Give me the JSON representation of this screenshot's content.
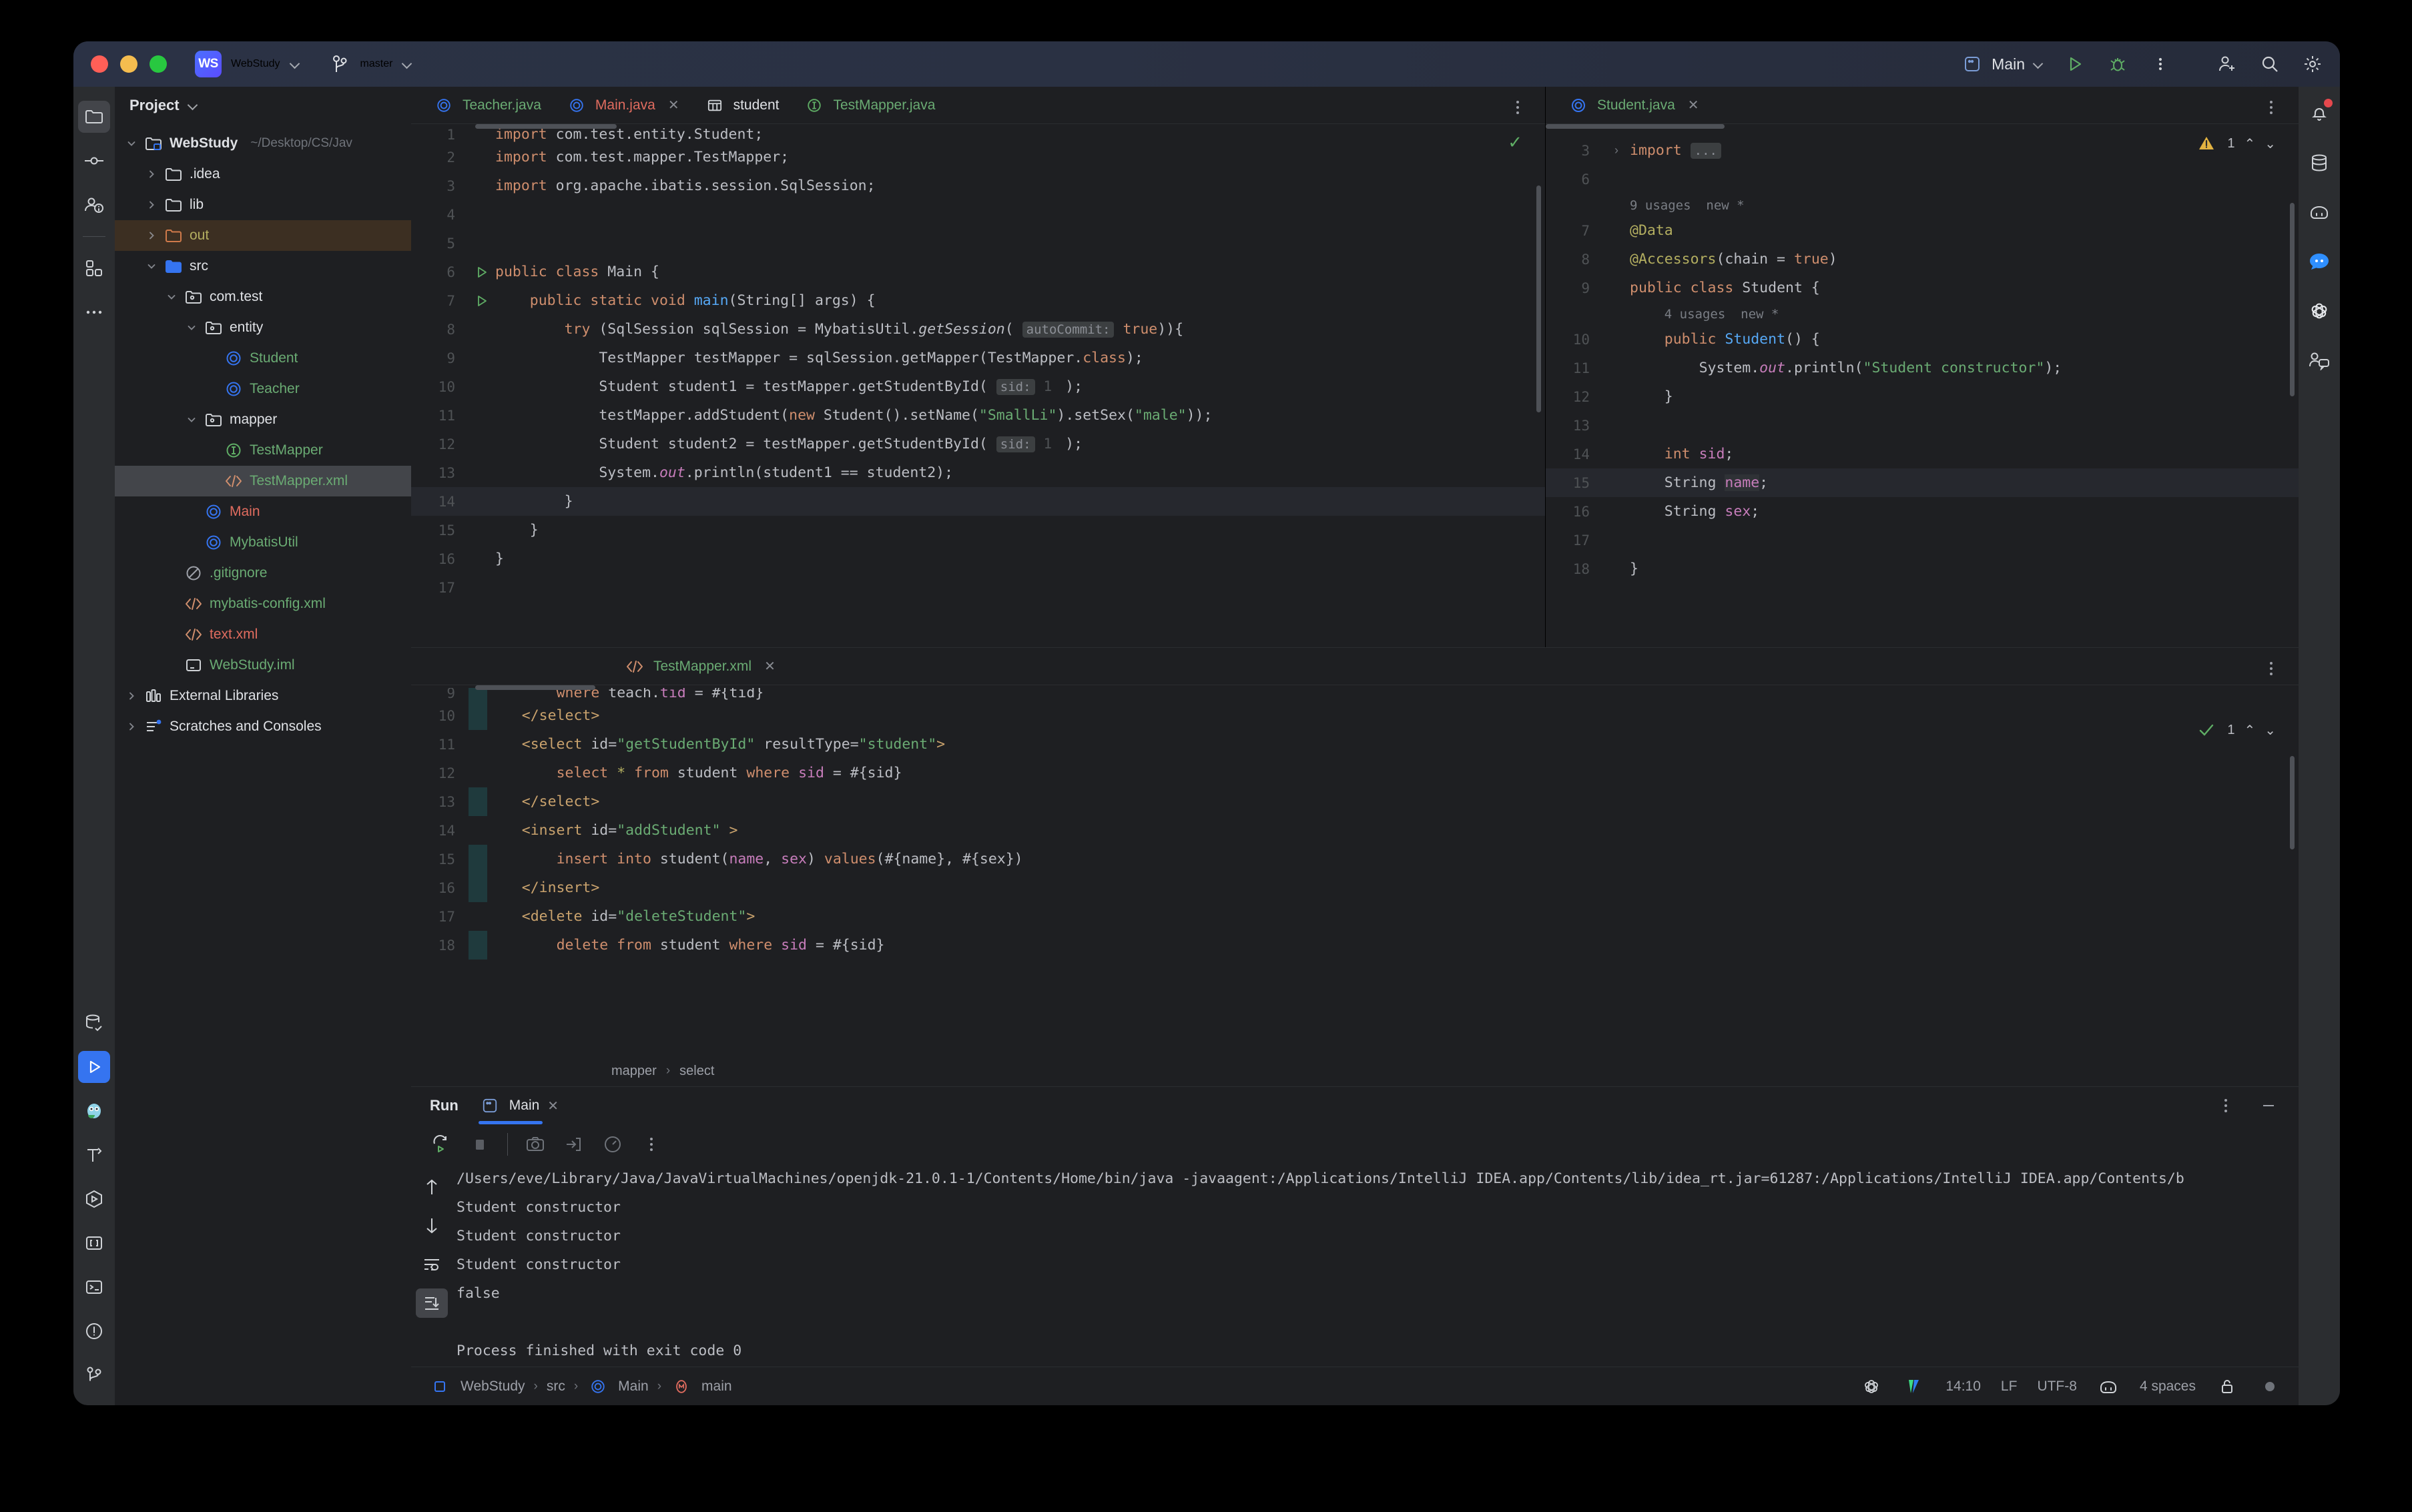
{
  "titlebar": {
    "project_badge": "WS",
    "project_name": "WebStudy",
    "branch": "master",
    "run_config": "Main"
  },
  "left_rail": {
    "items": [
      {
        "name": "project-tool-window",
        "icon": "folder-icon",
        "active": true
      },
      {
        "name": "commit-tool-window",
        "icon": "commit-icon",
        "active": false
      },
      {
        "name": "pull-requests-tool-window",
        "icon": "pull-request-icon",
        "active": false
      },
      {
        "name": "structure-tool-window",
        "icon": "structure-icon",
        "active": false
      },
      {
        "name": "more-tool-windows",
        "icon": "more-dots-icon",
        "active": false
      }
    ],
    "bottom_items": [
      {
        "name": "database-tool-window",
        "icon": "database-check-icon",
        "active": false
      },
      {
        "name": "run-tool-window",
        "icon": "run-icon",
        "active": true
      },
      {
        "name": "owl-assistant",
        "icon": "owl-icon",
        "active": false
      },
      {
        "name": "build-tool-window",
        "icon": "hammer-icon",
        "active": false
      },
      {
        "name": "services-tool-window",
        "icon": "services-icon",
        "active": false
      },
      {
        "name": "bracket-tool-window",
        "icon": "brackets-icon",
        "active": false
      },
      {
        "name": "terminal-tool-window",
        "icon": "terminal-icon",
        "active": false
      },
      {
        "name": "problems-tool-window",
        "icon": "warning-circle-icon",
        "active": false
      },
      {
        "name": "git-tool-window",
        "icon": "git-branch-icon",
        "active": false
      }
    ]
  },
  "right_rail": {
    "items": [
      {
        "name": "notifications",
        "icon": "bell-icon",
        "badge": true
      },
      {
        "name": "database",
        "icon": "database-icon",
        "badge": false
      },
      {
        "name": "copilot",
        "icon": "robot-icon",
        "badge": false
      },
      {
        "name": "chat",
        "icon": "chat-bubble-icon",
        "badge": false
      },
      {
        "name": "openai-assistant",
        "icon": "openai-icon",
        "badge": false
      },
      {
        "name": "code-with-me",
        "icon": "people-chat-icon",
        "badge": false
      }
    ]
  },
  "project_panel": {
    "title": "Project",
    "tree": [
      {
        "label": "WebStudy",
        "suffix": "~/Desktop/CS/Jav",
        "depth": 0,
        "twist": "down",
        "icon": "module-folder-icon",
        "color": "white",
        "bold": true,
        "state": "normal"
      },
      {
        "label": ".idea",
        "suffix": "",
        "depth": 1,
        "twist": "right",
        "icon": "folder-icon",
        "color": "white",
        "bold": false,
        "state": "normal"
      },
      {
        "label": "lib",
        "suffix": "",
        "depth": 1,
        "twist": "right",
        "icon": "folder-icon",
        "color": "white",
        "bold": false,
        "state": "normal"
      },
      {
        "label": "out",
        "suffix": "",
        "depth": 1,
        "twist": "right",
        "icon": "folder-excluded-icon",
        "color": "yellow",
        "bold": false,
        "state": "highlight"
      },
      {
        "label": "src",
        "suffix": "",
        "depth": 1,
        "twist": "down",
        "icon": "source-folder-icon",
        "color": "white",
        "bold": false,
        "state": "normal"
      },
      {
        "label": "com.test",
        "suffix": "",
        "depth": 2,
        "twist": "down",
        "icon": "package-icon",
        "color": "white",
        "bold": false,
        "state": "normal"
      },
      {
        "label": "entity",
        "suffix": "",
        "depth": 3,
        "twist": "down",
        "icon": "package-icon",
        "color": "white",
        "bold": false,
        "state": "normal"
      },
      {
        "label": "Student",
        "suffix": "",
        "depth": 4,
        "twist": "none",
        "icon": "java-class-icon",
        "color": "green",
        "bold": false,
        "state": "normal"
      },
      {
        "label": "Teacher",
        "suffix": "",
        "depth": 4,
        "twist": "none",
        "icon": "java-class-icon",
        "color": "green",
        "bold": false,
        "state": "normal"
      },
      {
        "label": "mapper",
        "suffix": "",
        "depth": 3,
        "twist": "down",
        "icon": "package-icon",
        "color": "white",
        "bold": false,
        "state": "normal"
      },
      {
        "label": "TestMapper",
        "suffix": "",
        "depth": 4,
        "twist": "none",
        "icon": "java-interface-icon",
        "color": "green",
        "bold": false,
        "state": "normal"
      },
      {
        "label": "TestMapper.xml",
        "suffix": "",
        "depth": 4,
        "twist": "none",
        "icon": "xml-icon",
        "color": "green",
        "bold": false,
        "state": "selected"
      },
      {
        "label": "Main",
        "suffix": "",
        "depth": 3,
        "twist": "none",
        "icon": "java-class-icon",
        "color": "red",
        "bold": false,
        "state": "normal"
      },
      {
        "label": "MybatisUtil",
        "suffix": "",
        "depth": 3,
        "twist": "none",
        "icon": "java-class-icon",
        "color": "green",
        "bold": false,
        "state": "normal"
      },
      {
        "label": ".gitignore",
        "suffix": "",
        "depth": 2,
        "twist": "none",
        "icon": "gitignore-icon",
        "color": "green",
        "bold": false,
        "state": "normal"
      },
      {
        "label": "mybatis-config.xml",
        "suffix": "",
        "depth": 2,
        "twist": "none",
        "icon": "xml-icon",
        "color": "green",
        "bold": false,
        "state": "normal"
      },
      {
        "label": "text.xml",
        "suffix": "",
        "depth": 2,
        "twist": "none",
        "icon": "xml-icon",
        "color": "red",
        "bold": false,
        "state": "normal"
      },
      {
        "label": "WebStudy.iml",
        "suffix": "",
        "depth": 2,
        "twist": "none",
        "icon": "iml-icon",
        "color": "green",
        "bold": false,
        "state": "normal"
      },
      {
        "label": "External Libraries",
        "suffix": "",
        "depth": 0,
        "twist": "right",
        "icon": "libraries-icon",
        "color": "white",
        "bold": false,
        "state": "normal"
      },
      {
        "label": "Scratches and Consoles",
        "suffix": "",
        "depth": 0,
        "twist": "right",
        "icon": "scratches-icon",
        "color": "white",
        "bold": false,
        "state": "normal"
      }
    ]
  },
  "main_editor": {
    "tabs": [
      {
        "label": "Teacher.java",
        "icon": "java-class-icon",
        "color": "green",
        "active": false,
        "closable": false
      },
      {
        "label": "Main.java",
        "icon": "java-class-icon",
        "color": "red",
        "active": true,
        "closable": true
      },
      {
        "label": "student",
        "icon": "table-icon",
        "color": "white",
        "active": false,
        "closable": false
      },
      {
        "label": "TestMapper.java",
        "icon": "java-interface-icon",
        "color": "green",
        "active": false,
        "closable": false
      }
    ],
    "lines": [
      {
        "num": "1",
        "gutter": "",
        "clipped": true
      },
      {
        "num": "2",
        "gutter": "",
        "clipped": false
      },
      {
        "num": "3",
        "gutter": "",
        "clipped": false
      },
      {
        "num": "4",
        "gutter": "",
        "clipped": false
      },
      {
        "num": "5",
        "gutter": "",
        "clipped": false
      },
      {
        "num": "6",
        "gutter": "run",
        "clipped": false
      },
      {
        "num": "7",
        "gutter": "run",
        "clipped": false
      },
      {
        "num": "8",
        "gutter": "",
        "clipped": false
      },
      {
        "num": "9",
        "gutter": "",
        "clipped": false
      },
      {
        "num": "10",
        "gutter": "",
        "clipped": false
      },
      {
        "num": "11",
        "gutter": "",
        "clipped": false
      },
      {
        "num": "12",
        "gutter": "",
        "clipped": false
      },
      {
        "num": "13",
        "gutter": "",
        "clipped": false
      },
      {
        "num": "14",
        "gutter": "",
        "clipped": false
      },
      {
        "num": "15",
        "gutter": "",
        "clipped": false
      },
      {
        "num": "16",
        "gutter": "",
        "clipped": false
      },
      {
        "num": "17",
        "gutter": "",
        "clipped": false
      }
    ],
    "code_text": {
      "l1": "import com.test.entity.Student;",
      "l2": "import com.test.mapper.TestMapper;",
      "l3": "import org.apache.ibatis.session.SqlSession;",
      "l6": "public class Main {",
      "l7": "    public static void main(String[] args) {",
      "l8": "        try (SqlSession sqlSession = MybatisUtil.getSession( autoCommit: true)){",
      "l9": "            TestMapper testMapper = sqlSession.getMapper(TestMapper.class);",
      "l10": "            Student student1 = testMapper.getStudentById( sid: 1);",
      "l11": "            testMapper.addStudent(new Student().setName(\"SmallLi\").setSex(\"male\"));",
      "l12": "            Student student2 = testMapper.getStudentById( sid: 1);",
      "l13": "            System.out.println(student1 == student2);",
      "l14": "        }",
      "l15": "    }",
      "l16": "}"
    },
    "inspection_ok": "✓"
  },
  "side_editor": {
    "tab": {
      "label": "Student.java",
      "icon": "java-class-icon",
      "color": "green",
      "closable": true
    },
    "inspection": {
      "warning_count": "1",
      "icon": "warning-triangle-icon"
    },
    "lines": [
      {
        "num": "3"
      },
      {
        "num": "6"
      },
      {
        "num": "7"
      },
      {
        "num": "8"
      },
      {
        "num": "9"
      },
      {
        "num": "10"
      },
      {
        "num": "11"
      },
      {
        "num": "12"
      },
      {
        "num": "13"
      },
      {
        "num": "14"
      },
      {
        "num": "15"
      },
      {
        "num": "16"
      },
      {
        "num": "17"
      },
      {
        "num": "18"
      }
    ],
    "usages_class": "9 usages",
    "usages_class_new": "new *",
    "usages_ctor": "4 usages",
    "usages_ctor_new": "new *",
    "code_text": {
      "l3": "import ...",
      "l7": "@Data",
      "l8": "@Accessors(chain = true)",
      "l9": "public class Student {",
      "l10": "    public Student() {",
      "l11": "        System.out.println(\"Student constructor\");",
      "l12": "    }",
      "l14": "    int sid;",
      "l15": "    String name;",
      "l16": "    String sex;",
      "l18": "}"
    }
  },
  "xml_editor": {
    "tab": {
      "label": "TestMapper.xml",
      "icon": "xml-icon",
      "color": "green",
      "closable": true
    },
    "inspection": {
      "ok_count": "1",
      "icon": "check-icon"
    },
    "lines": [
      {
        "num": "9"
      },
      {
        "num": "10"
      },
      {
        "num": "11"
      },
      {
        "num": "12"
      },
      {
        "num": "13"
      },
      {
        "num": "14"
      },
      {
        "num": "15"
      },
      {
        "num": "16"
      },
      {
        "num": "17"
      },
      {
        "num": "18"
      }
    ],
    "code_text": {
      "l9": "        where teach.tid = #{tid}",
      "l10": "    </select>",
      "l11": "    <select id=\"getStudentById\" resultType=\"student\">",
      "l12": "        select * from student where sid = #{sid}",
      "l13": "    </select>",
      "l14": "    <insert id=\"addStudent\" >",
      "l15": "        insert into student(name, sex) values(#{name}, #{sex})",
      "l16": "    </insert>",
      "l17": "    <delete id=\"deleteStudent\">",
      "l18": "        delete from student where sid = #{sid}"
    },
    "breadcrumb": [
      "mapper",
      "select"
    ]
  },
  "run_panel": {
    "title": "Run",
    "tab_label": "Main",
    "toolbar": [
      {
        "name": "rerun-button",
        "icon": "rerun-icon"
      },
      {
        "name": "stop-button",
        "icon": "stop-icon"
      },
      {
        "name": "screenshot-button",
        "icon": "camera-icon"
      },
      {
        "name": "export-button",
        "icon": "export-icon"
      },
      {
        "name": "profiler-button",
        "icon": "gauge-icon"
      },
      {
        "name": "more-options-button",
        "icon": "kebab-icon"
      }
    ],
    "console_rail": [
      {
        "name": "scroll-up-button",
        "icon": "arrow-up-icon",
        "active": false
      },
      {
        "name": "scroll-down-button",
        "icon": "arrow-down-icon",
        "active": false
      },
      {
        "name": "soft-wrap-button",
        "icon": "soft-wrap-icon",
        "active": false
      },
      {
        "name": "scroll-to-end-button",
        "icon": "scroll-end-icon",
        "active": true
      }
    ],
    "output": [
      "/Users/eve/Library/Java/JavaVirtualMachines/openjdk-21.0.1-1/Contents/Home/bin/java -javaagent:/Applications/IntelliJ IDEA.app/Contents/lib/idea_rt.jar=61287:/Applications/IntelliJ IDEA.app/Contents/b",
      "Student constructor",
      "Student constructor",
      "Student constructor",
      "false",
      "",
      "Process finished with exit code 0"
    ]
  },
  "status_bar": {
    "breadcrumb": [
      "WebStudy",
      "src",
      "Main",
      "main"
    ],
    "line_col": "14:10",
    "line_sep": "LF",
    "encoding": "UTF-8",
    "indent": "4 spaces",
    "icons": [
      "openai-icon",
      "vpn-icon",
      "copilot-icon",
      "lock-icon",
      "inspection-icon"
    ]
  },
  "colors": {
    "accent_blue": "#3574f0",
    "green": "#6aab73",
    "red": "#e06c5f",
    "orange": "#cf8e6d",
    "magenta": "#c77dbb",
    "yellow": "#b3ae60",
    "cyan": "#2aacb8",
    "bg_editor": "#1e1f22",
    "bg_panel": "#2b2d30"
  }
}
